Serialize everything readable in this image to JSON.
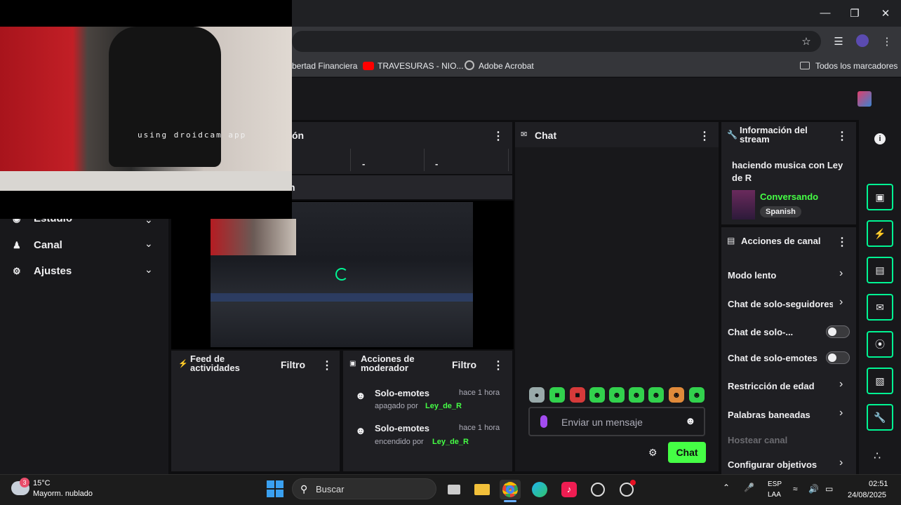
{
  "browser": {
    "bookmarks": [
      {
        "label": "bertad Financiera"
      },
      {
        "label": "TRAVESURAS - NIO..."
      },
      {
        "label": "Adobe Acrobat"
      }
    ],
    "all_bookmarks": "Todos los marcadores"
  },
  "sidebar": {
    "items": [
      {
        "label": "Estudio"
      },
      {
        "label": "Canal"
      },
      {
        "label": "Ajustes"
      }
    ]
  },
  "cam": {
    "watermark": "using droidcam app"
  },
  "stats_panel": {
    "title_suffix": "ón",
    "cells": [
      "-",
      "-"
    ],
    "row2_suffix": "n"
  },
  "activity_feed": {
    "title": "Feed de actividades",
    "filter": "Filtro"
  },
  "mod_actions": {
    "title": "Acciones de moderador",
    "filter": "Filtro",
    "items": [
      {
        "action": "Solo-emotes",
        "time": "hace 1 hora",
        "state": "apagado por",
        "user": "Ley_de_R"
      },
      {
        "action": "Solo-emotes",
        "time": "hace 1 hora",
        "state": "encendido por",
        "user": "Ley_de_R"
      }
    ]
  },
  "chat": {
    "title": "Chat",
    "placeholder": "Enviar un mensaje",
    "send_label": "Chat"
  },
  "stream_info": {
    "title": "Información del stream",
    "stream_title": "haciendo musica con Ley de R",
    "category": "Conversando",
    "tag": "Spanish"
  },
  "channel_actions": {
    "title": "Acciones de canal",
    "items": [
      {
        "label": "Modo lento"
      },
      {
        "label": "Chat de solo-seguidores"
      },
      {
        "label": "Chat de solo-..."
      },
      {
        "label": "Chat de solo-emotes"
      },
      {
        "label": "Restricción de edad"
      },
      {
        "label": "Palabras baneadas"
      },
      {
        "label": "Hostear canal"
      },
      {
        "label": "Configurar objetivos"
      }
    ]
  },
  "taskbar": {
    "weather_badge": "3",
    "temperature": "15°C",
    "weather_desc": "Mayorm. nublado",
    "search_label": "Buscar",
    "lang_top": "ESP",
    "lang_bottom": "LAA",
    "time": "02:51",
    "date": "24/08/2025"
  },
  "colors": {
    "accent_green": "#00f593",
    "chat_button": "#45ff45",
    "panel_bg": "#1f1f23"
  }
}
